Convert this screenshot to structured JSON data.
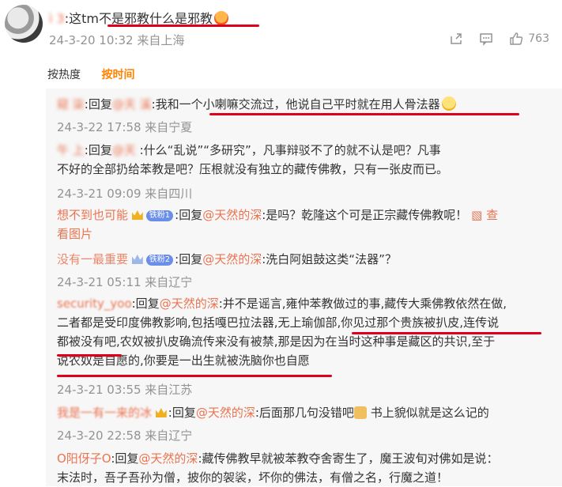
{
  "top_comment": {
    "username": "ì          3",
    "text": ":这tm不是邪教什么是邪教",
    "time": "24-3-20 10:32",
    "location": "来自上海",
    "likes": "763"
  },
  "sort_tabs": {
    "hot": "按热度",
    "time": "按时间"
  },
  "replies": [
    {
      "user": "窥     柒",
      "reply_prefix": ":回复",
      "target": "@天    溪",
      "text": ":我和一个小喇嘛交流过，他说自己平时就在用人骨法器",
      "meta": "24-3-22 17:58 来自宁夏"
    },
    {
      "user": "午    上",
      "reply_prefix": ":回复",
      "target": "@天    ",
      "text_line1": ":什么“乱说”“多研究”，凡事辩驳不了的就不认是吧？凡事",
      "text_line2": "不好的全部扔给苯教是吧？压根就没有独立的藏传佛教，只有一张皮而已。",
      "meta": "24-3-21 09:09 来自四川"
    },
    {
      "user": "想不到也可能",
      "badge": "铁粉1",
      "reply_prefix": ":回复",
      "target": "@天然的深",
      "text": ":是吗？乾隆这个可是正宗藏传佛教呢！",
      "link_line1": "查",
      "link_line2": "看图片"
    },
    {
      "user": "没有一最重要",
      "badge": "铁粉2",
      "reply_prefix": ":回复",
      "target": "@天然的深",
      "text": ":洗白阿姐鼓这类“法器”？",
      "meta": "24-3-21 05:11 来自辽宁"
    },
    {
      "user": "security_yoo",
      "reply_prefix": ":回复",
      "target": "@天然的深",
      "text_line1": ":并不是谣言,雍仲苯教做过的事,藏传大乘佛教依然在做,",
      "text_line2": "二者都是受印度佛教影响,包括嘎巴拉法器,无上瑜伽部,你见过那个贵族被扒皮,连传说",
      "text_line3": "都被没有吧,农奴被扒皮确流传来没有被禁,那是因为在当时这种事是藏区的共识,至于",
      "text_line4": "说农奴是自愿的,你要是一出生就被洗脑你也自愿",
      "meta": "24-3-21 03:55 来自江苏"
    },
    {
      "user": "我是一有一来的冰",
      "reply_prefix": ":回复",
      "target": "@天然的深",
      "text": ":后面那几句没错吧",
      "text_after_icon": "书上貌似就是这么记的",
      "meta": "24-3-20 22:58 来自辽宁"
    },
    {
      "user": "O阳伢子O",
      "reply_prefix": ":回复",
      "target": "@天然的深",
      "text_line1": ":藏传佛教早就被苯教夺舍寄生了，魔王波旬对佛如是说：",
      "text_line2": "末法时，吾子吾孙为僧，披你的袈裟，坏你的佛法，有僧之名，行魔之道！"
    }
  ]
}
